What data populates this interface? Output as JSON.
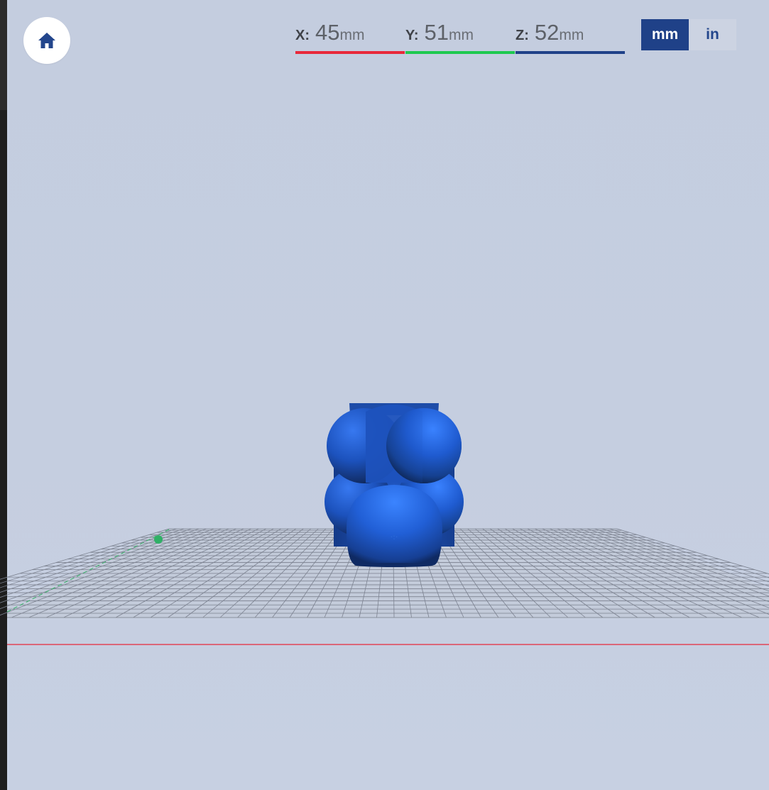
{
  "toolbar": {
    "home_icon": "home-icon"
  },
  "dimensions": {
    "x": {
      "axis": "X:",
      "value": "45",
      "unit": "mm",
      "color": "#e8283a"
    },
    "y": {
      "axis": "Y:",
      "value": "51",
      "unit": "mm",
      "color": "#1ec94f"
    },
    "z": {
      "axis": "Z:",
      "value": "52",
      "unit": "mm",
      "color": "#1f4188"
    }
  },
  "unit_toggle": {
    "mm_label": "mm",
    "in_label": "in",
    "selected": "mm"
  },
  "colors": {
    "background": "#c4cddf",
    "model": "#1f5bd0",
    "accent": "#1f4188",
    "x_axis_line": "#e8283a",
    "y_axis_line": "#1ec94f"
  }
}
